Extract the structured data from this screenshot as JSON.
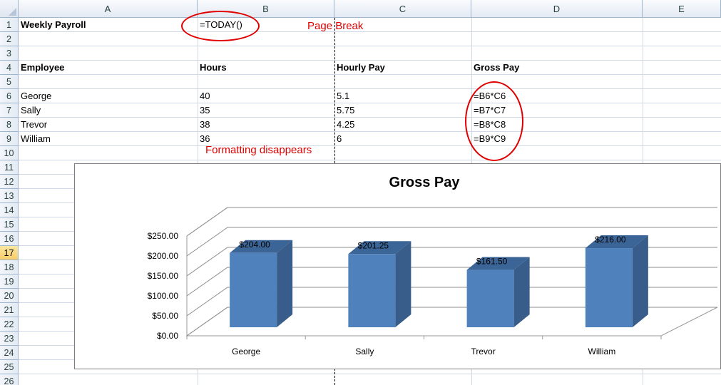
{
  "columns": [
    "A",
    "B",
    "C",
    "D",
    "E"
  ],
  "rows": [
    "1",
    "2",
    "3",
    "4",
    "5",
    "6",
    "7",
    "8",
    "9",
    "10",
    "11",
    "12",
    "13",
    "14",
    "15",
    "16",
    "17",
    "18",
    "19",
    "20",
    "21",
    "22",
    "23",
    "24",
    "25",
    "26"
  ],
  "active_row": "17",
  "cells": {
    "A1": "Weekly Payroll",
    "B1": "=TODAY()",
    "A4": "Employee",
    "B4": "Hours",
    "C4": "Hourly Pay",
    "D4": "Gross Pay",
    "A6": "George",
    "B6": "40",
    "C6": "5.1",
    "D6": "=B6*C6",
    "A7": "Sally",
    "B7": "35",
    "C7": "5.75",
    "D7": "=B7*C7",
    "A8": "Trevor",
    "B8": "38",
    "C8": "4.25",
    "D8": "=B8*C8",
    "A9": "William",
    "B9": "36",
    "C9": "6",
    "D9": "=B9*C9"
  },
  "annotations": {
    "page_break": "Page Break",
    "formatting": "Formatting disappears",
    "color": "#e00000"
  },
  "chart_data": {
    "type": "bar",
    "title": "Gross Pay",
    "categories": [
      "George",
      "Sally",
      "Trevor",
      "William"
    ],
    "values": [
      204.0,
      201.25,
      161.5,
      216.0
    ],
    "data_labels": [
      "$204.00",
      "$201.25",
      "$161.50",
      "$216.00"
    ],
    "y_ticks": [
      "$0.00",
      "$50.00",
      "$100.00",
      "$150.00",
      "$200.00",
      "$250.00"
    ],
    "ylim": [
      0,
      250
    ],
    "xlabel": "",
    "ylabel": "",
    "grid": true,
    "legend": "none",
    "three_d": true,
    "bar_color": "#4f81bd",
    "bar_side_color": "#385d8a",
    "bar_top_color": "#3c6597"
  }
}
